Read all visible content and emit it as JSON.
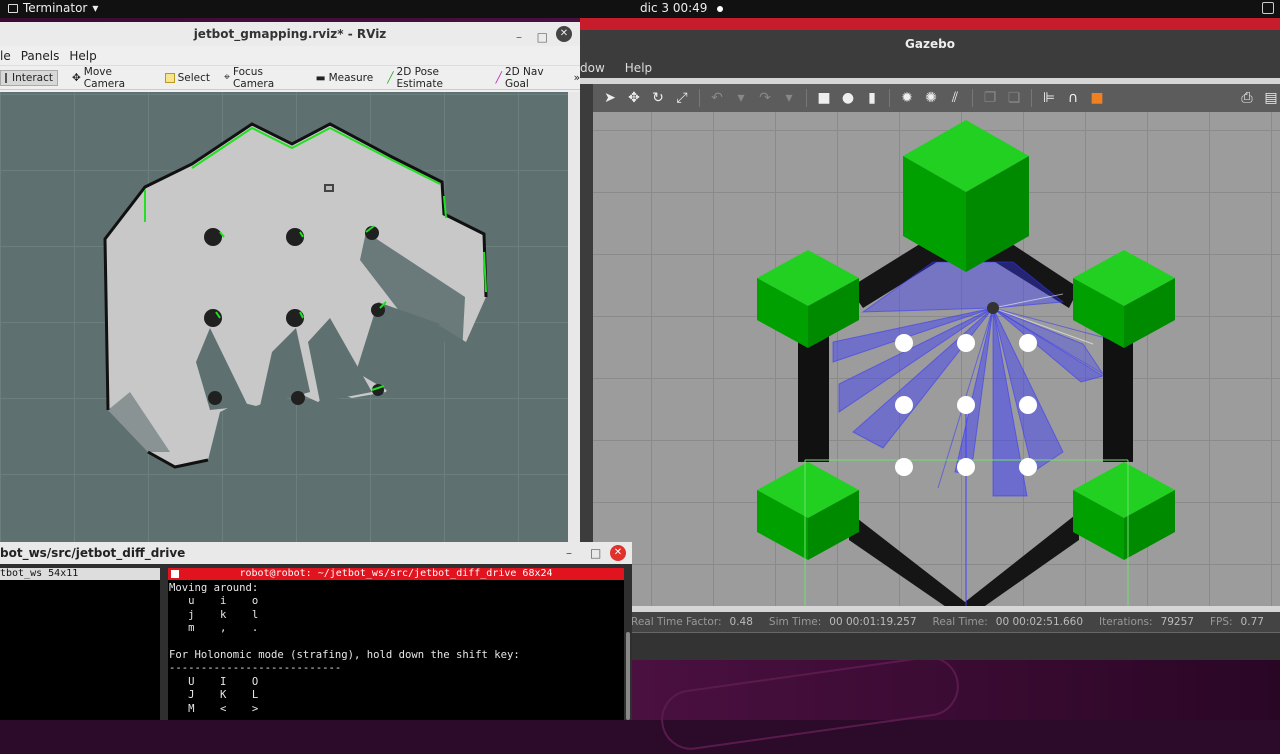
{
  "topbar": {
    "app_name": "Terminator",
    "app_arrow": "▾",
    "clock": "dic 3  00:49"
  },
  "rviz": {
    "title": "jetbot_gmapping.rviz* - RViz",
    "controls": {
      "minimize": "–",
      "maximize": "□",
      "close": "✕"
    },
    "menu": [
      "le",
      "Panels",
      "Help"
    ],
    "tools": [
      {
        "label": "Interact",
        "icon": "interact-icon",
        "active": true
      },
      {
        "label": "Move Camera",
        "icon": "move-camera-icon"
      },
      {
        "label": "Select",
        "icon": "select-icon"
      },
      {
        "label": "Focus Camera",
        "icon": "focus-camera-icon"
      },
      {
        "label": "Measure",
        "icon": "measure-icon"
      },
      {
        "label": "2D Pose Estimate",
        "icon": "pose-estimate-icon"
      },
      {
        "label": "2D Nav Goal",
        "icon": "nav-goal-icon"
      }
    ],
    "overflow": "»",
    "colors": {
      "map_free": "#c8c8c8",
      "map_unknown": "#5f7070",
      "map_occupied": "#101010",
      "laser": "#22e022"
    }
  },
  "gazebo": {
    "title": "Gazebo",
    "menu": [
      "dow",
      "Help"
    ],
    "status": {
      "real_time_factor_label": "Real Time Factor:",
      "real_time_factor": "0.48",
      "sim_time_label": "Sim Time:",
      "sim_time": "00 00:01:19.257",
      "real_time_label": "Real Time:",
      "real_time": "00 00:02:51.660",
      "iterations_label": "Iterations:",
      "iterations": "79257",
      "fps_label": "FPS:",
      "fps": "0.77"
    },
    "colors": {
      "cube": "#00b000",
      "wall": "#151515",
      "laser": "#3030ff",
      "ground": "#9c9c9c"
    }
  },
  "terminal": {
    "title": "bot_ws/src/jetbot_diff_drive",
    "controls": {
      "minimize": "–",
      "maximize": "□",
      "close": "✕"
    },
    "left_pane_header": "tbot_ws 54x11",
    "right_pane_header": "robot@robot: ~/jetbot_ws/src/jetbot_diff_drive 68x24",
    "lines": [
      "Moving around:",
      "   u    i    o",
      "   j    k    l",
      "   m    ,    .",
      "",
      "For Holonomic mode (strafing), hold down the shift key:",
      "---------------------------",
      "   U    I    O",
      "   J    K    L",
      "   M    <    >"
    ]
  }
}
